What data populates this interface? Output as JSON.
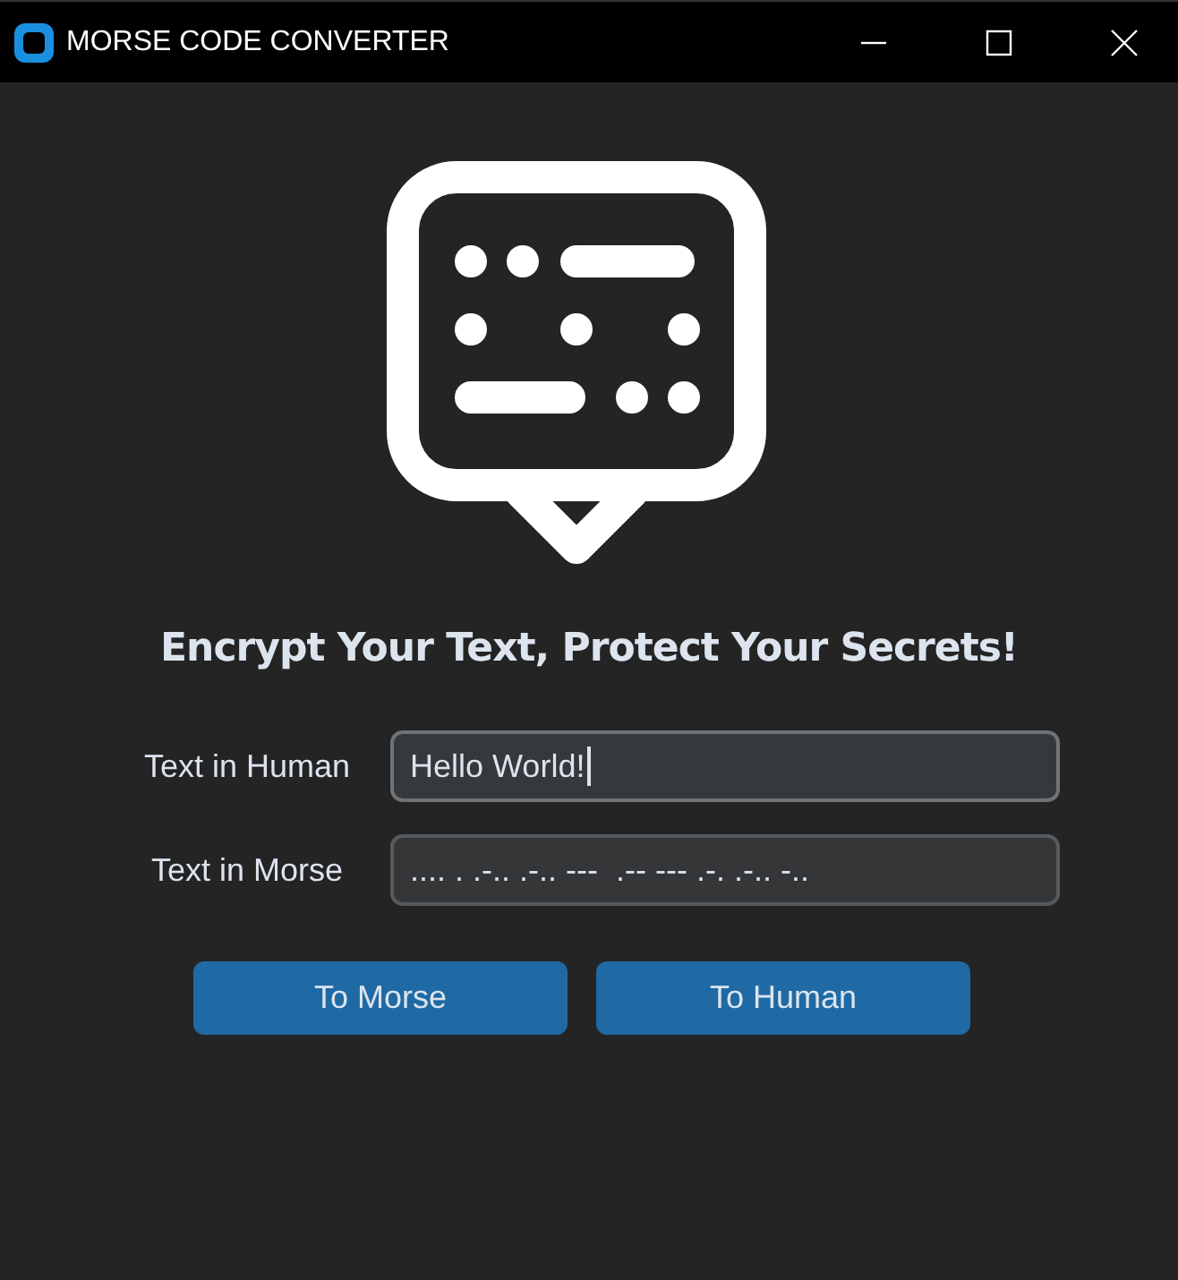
{
  "window": {
    "title": "MORSE CODE CONVERTER"
  },
  "heading": "Encrypt Your Text, Protect Your Secrets!",
  "fields": [
    {
      "label": "Text in Human",
      "value": "Hello World!",
      "focused": true
    },
    {
      "label": "Text in Morse",
      "value": ".... . .-.. .-.. ---  .-- --- .-. .-.. -..",
      "focused": false
    }
  ],
  "buttons": [
    "To Morse",
    "To Human"
  ]
}
